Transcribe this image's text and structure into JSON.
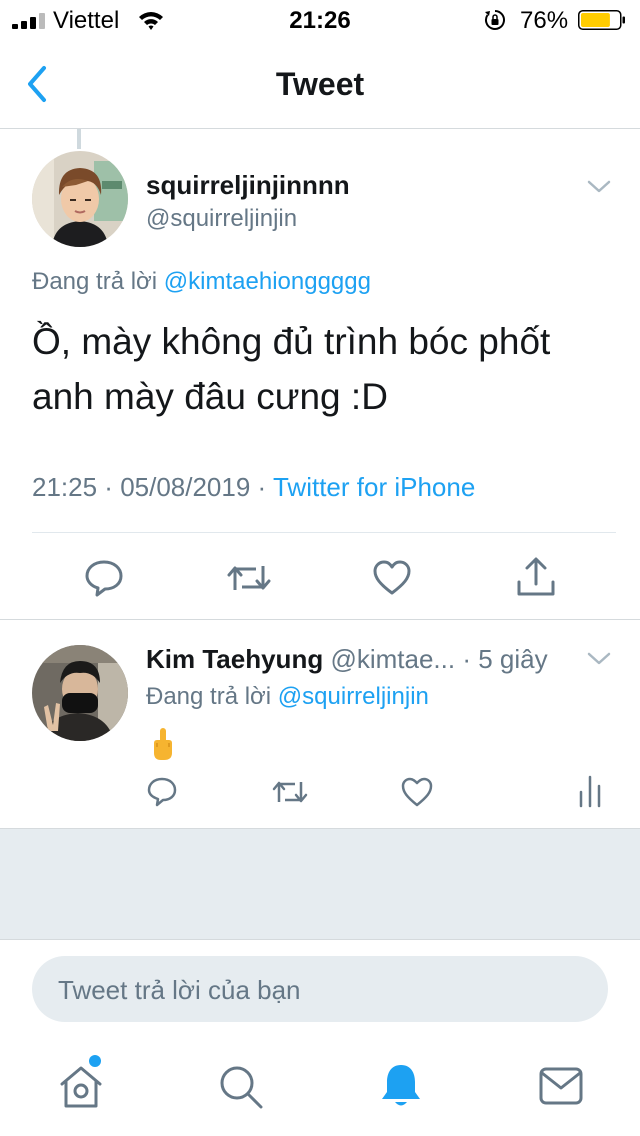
{
  "status_bar": {
    "carrier": "Viettel",
    "time": "21:26",
    "battery_percent": "76%",
    "battery_level": 0.76,
    "battery_color": "#ffcc00"
  },
  "nav": {
    "title": "Tweet",
    "back_icon": "chevron-left-icon",
    "accent_color": "#1da1f2"
  },
  "main_tweet": {
    "display_name": "squirreljinjinnnn",
    "handle": "@squirreljinjin",
    "replying_prefix": "Đang trả lời",
    "replying_to": "@kimtaehionggggg",
    "text": "Ồ, mày không đủ trình bóc phốt anh mày đâu cưng :D",
    "timestamp": "21:25",
    "date": "05/08/2019",
    "separator": " · ",
    "source": "Twitter for iPhone",
    "actions": [
      "reply-icon",
      "retweet-icon",
      "like-icon",
      "share-icon"
    ]
  },
  "reply_tweet": {
    "display_name": "Kim Taehyung",
    "handle": "@kimtae...",
    "separator": " · ",
    "time_ago": "5 giây",
    "replying_prefix": "Đang trả lời",
    "replying_to": "@squirreljinjin",
    "content_icon": "middle-finger-emoji",
    "actions": [
      "reply-icon",
      "retweet-icon",
      "like-icon",
      "analytics-icon"
    ]
  },
  "compose": {
    "placeholder": "Tweet trả lời của bạn"
  },
  "tab_bar": {
    "items": [
      "home-icon",
      "search-icon",
      "notifications-icon",
      "messages-icon"
    ],
    "active": "notifications-icon",
    "home_has_badge": true
  }
}
